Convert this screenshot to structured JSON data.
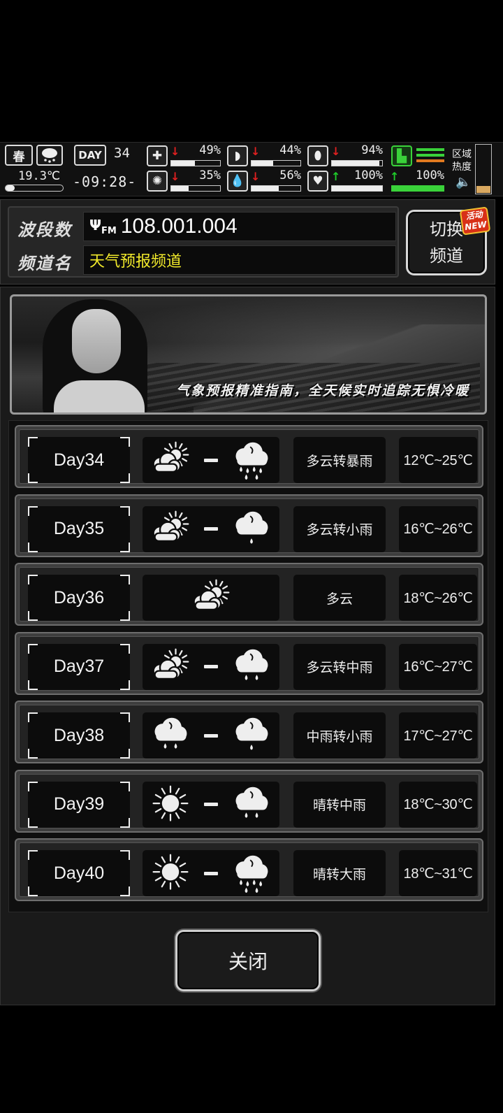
{
  "hud": {
    "season": "春",
    "temperature": "19.3℃",
    "day_label": "DAY",
    "day_number": "34",
    "clock": "-09:28-",
    "stats": [
      {
        "icon": "medkit-icon",
        "trend": "down",
        "percent": "49%",
        "level": 0.49
      },
      {
        "icon": "stomach-icon",
        "trend": "down",
        "percent": "44%",
        "level": 0.44
      },
      {
        "icon": "pill-icon",
        "trend": "down",
        "percent": "94%",
        "level": 0.94
      },
      {
        "icon": "brain-icon",
        "trend": "down",
        "percent": "35%",
        "level": 0.35
      },
      {
        "icon": "water-drop-icon",
        "trend": "down",
        "percent": "56%",
        "level": 0.56
      },
      {
        "icon": "heart-icon",
        "trend": "up",
        "percent": "100%",
        "level": 1.0
      },
      {
        "icon": "boot-icon",
        "trend": "up",
        "percent": "100%",
        "level": 1.0
      }
    ],
    "zone_heat_label_1": "区域",
    "zone_heat_label_2": "热度"
  },
  "radio": {
    "band_label": "波段数",
    "frequency": "108.001.004",
    "channel_label": "频道名",
    "channel_name": "天气预报频道",
    "switch_line1": "切换",
    "switch_line2": "频道",
    "badge_line1": "活动",
    "badge_line2": "NEW"
  },
  "banner": {
    "slogan": "气象预报精准指南，全天候实时追踪无惧冷暖"
  },
  "forecast": [
    {
      "day": "Day34",
      "from": "partly-cloudy",
      "to": "rain-heavy",
      "desc": "多云转暴雨",
      "temp": "12℃~25℃"
    },
    {
      "day": "Day35",
      "from": "partly-cloudy",
      "to": "rain-light",
      "desc": "多云转小雨",
      "temp": "16℃~26℃"
    },
    {
      "day": "Day36",
      "from": "partly-cloudy",
      "to": null,
      "desc": "多云",
      "temp": "18℃~26℃"
    },
    {
      "day": "Day37",
      "from": "partly-cloudy",
      "to": "rain-medium",
      "desc": "多云转中雨",
      "temp": "16℃~27℃"
    },
    {
      "day": "Day38",
      "from": "rain-medium",
      "to": "rain-light",
      "desc": "中雨转小雨",
      "temp": "17℃~27℃"
    },
    {
      "day": "Day39",
      "from": "sunny",
      "to": "rain-medium",
      "desc": "晴转中雨",
      "temp": "18℃~30℃"
    },
    {
      "day": "Day40",
      "from": "sunny",
      "to": "rain-heavy",
      "desc": "晴转大雨",
      "temp": "18℃~31℃"
    }
  ],
  "footer": {
    "close_label": "关闭"
  },
  "colors": {
    "accent_yellow": "#f2ea2b",
    "down": "#e02020",
    "up": "#1fcc2a"
  }
}
